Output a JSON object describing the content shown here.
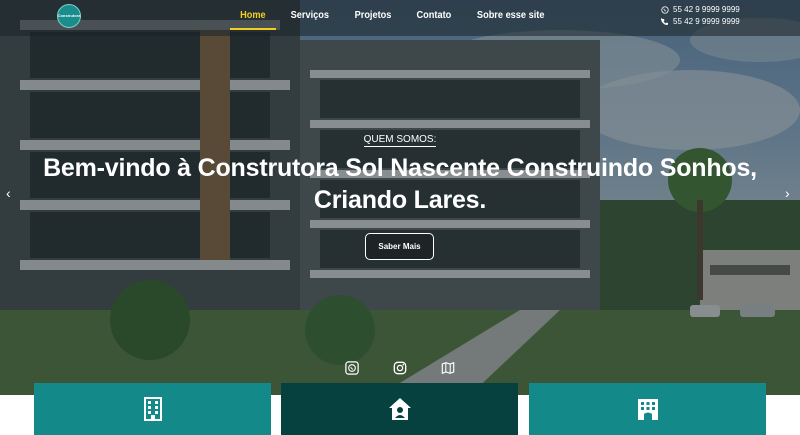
{
  "logo": {
    "text": "Construtora"
  },
  "nav": {
    "items": [
      {
        "label": "Home",
        "active": true
      },
      {
        "label": "Serviços",
        "active": false
      },
      {
        "label": "Projetos",
        "active": false
      },
      {
        "label": "Contato",
        "active": false
      },
      {
        "label": "Sobre esse site",
        "active": false
      }
    ]
  },
  "contacts": {
    "whatsapp": "55 42 9 9999 9999",
    "phone": "55 42 9 9999 9999",
    "icons": [
      "whatsapp-icon",
      "phone-icon"
    ]
  },
  "hero": {
    "kicker": "QUEM SOMOS:",
    "headline_line1": "Bem-vindo à Construtora Sol Nascente Construindo Sonhos,",
    "headline_line2": "Criando Lares.",
    "cta_label": "Saber Mais",
    "prev_arrow": "‹",
    "next_arrow": "›"
  },
  "socials": [
    "whatsapp-icon",
    "instagram-icon",
    "map-icon"
  ],
  "cards": [
    {
      "icon": "building-icon"
    },
    {
      "icon": "house-user-icon"
    },
    {
      "icon": "apartment-icon"
    }
  ],
  "colors": {
    "accent": "#f2cf22",
    "teal": "#138a89",
    "teal_dark": "#06413f"
  }
}
